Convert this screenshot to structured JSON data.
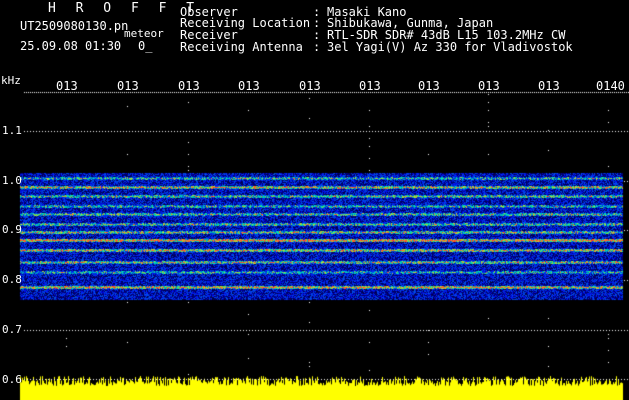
{
  "app": {
    "brand": "H R O F F T",
    "filename": "UT2509080130.pn",
    "file_type": "meteor",
    "timestamp": "25.09.08 01:30",
    "mark": "0_"
  },
  "header": {
    "rows": [
      {
        "label": "Observer",
        "sep": ":",
        "value": "Masaki Kano"
      },
      {
        "label": "Receiving Location",
        "sep": ":",
        "value": "Shibukawa, Gunma, Japan"
      },
      {
        "label": "Receiver",
        "sep": ":",
        "value": "RTL-SDR SDR# 43dB L15 103.2MHz CW"
      },
      {
        "label": "Receiving Antenna",
        "sep": ":",
        "value": "3el Yagi(V) Az 330 for Vladivostok"
      }
    ]
  },
  "colors": {
    "background": "#000000",
    "text": "#ffffff",
    "tick_label": "#ffff66",
    "spectrum_noise": "#1428c8",
    "strong_line": "#ff3030",
    "power_bar": "#ffff00"
  },
  "axes": {
    "y_unit": "kHz",
    "y_ticks": [
      "1.1",
      "1.0",
      "0.9",
      "0.8",
      "0.7",
      "0.6"
    ],
    "x_ticks": [
      "013",
      "013",
      "013",
      "013",
      "013",
      "013",
      "013",
      "013",
      "013",
      "0140"
    ]
  }
}
